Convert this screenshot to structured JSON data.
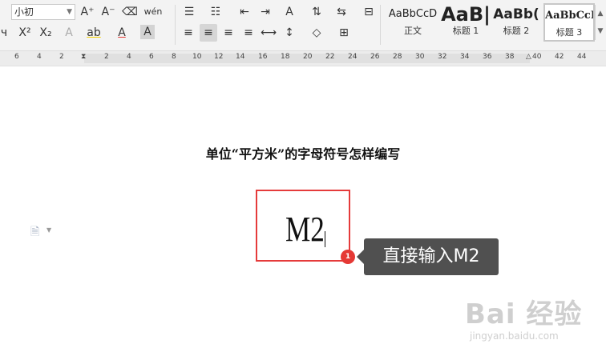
{
  "toolbar": {
    "font_size": "小初",
    "icons": {
      "grow_font": "A⁺",
      "shrink_font": "A⁻",
      "clear_format": "⌫",
      "pinyin": "wén",
      "superscript": "X²",
      "subscript": "X₂",
      "text_effect": "A",
      "highlight": "ab",
      "font_color": "A",
      "char_shading": "A",
      "bullets": "☰",
      "numbering": "☷",
      "decrease_indent": "⇤",
      "increase_indent": "⇥",
      "chinese_layout": "A",
      "sort": "⇅",
      "line_spacing_top": "⇆",
      "show_marks": "⊟",
      "align_left": "≡",
      "align_center": "≡",
      "align_right": "≡",
      "justify": "≡",
      "distributed": "⟷",
      "line_spacing": "↕",
      "shading": "◇",
      "borders": "⊞"
    },
    "styles": [
      {
        "preview": "AaBbCcD",
        "label": "正文"
      },
      {
        "preview": "AaB|",
        "label": "标题 1"
      },
      {
        "preview": "AaBb(",
        "label": "标题 2"
      },
      {
        "preview": "AaBbCcI",
        "label": "标题 3"
      }
    ]
  },
  "ruler": {
    "ticks": [
      "6",
      "4",
      "2",
      "2",
      "4",
      "6",
      "8",
      "10",
      "12",
      "14",
      "16",
      "18",
      "20",
      "22",
      "24",
      "26",
      "28",
      "30",
      "32",
      "34",
      "36",
      "38",
      "40",
      "42",
      "44"
    ]
  },
  "document": {
    "title": "单位“平方米”的字母符号怎样编写",
    "typed_text": "M2"
  },
  "annotation": {
    "badge": "1",
    "tooltip": "直接输入M2"
  },
  "watermark": {
    "logo": "Bai 经验",
    "url": "jingyan.baidu.com"
  }
}
